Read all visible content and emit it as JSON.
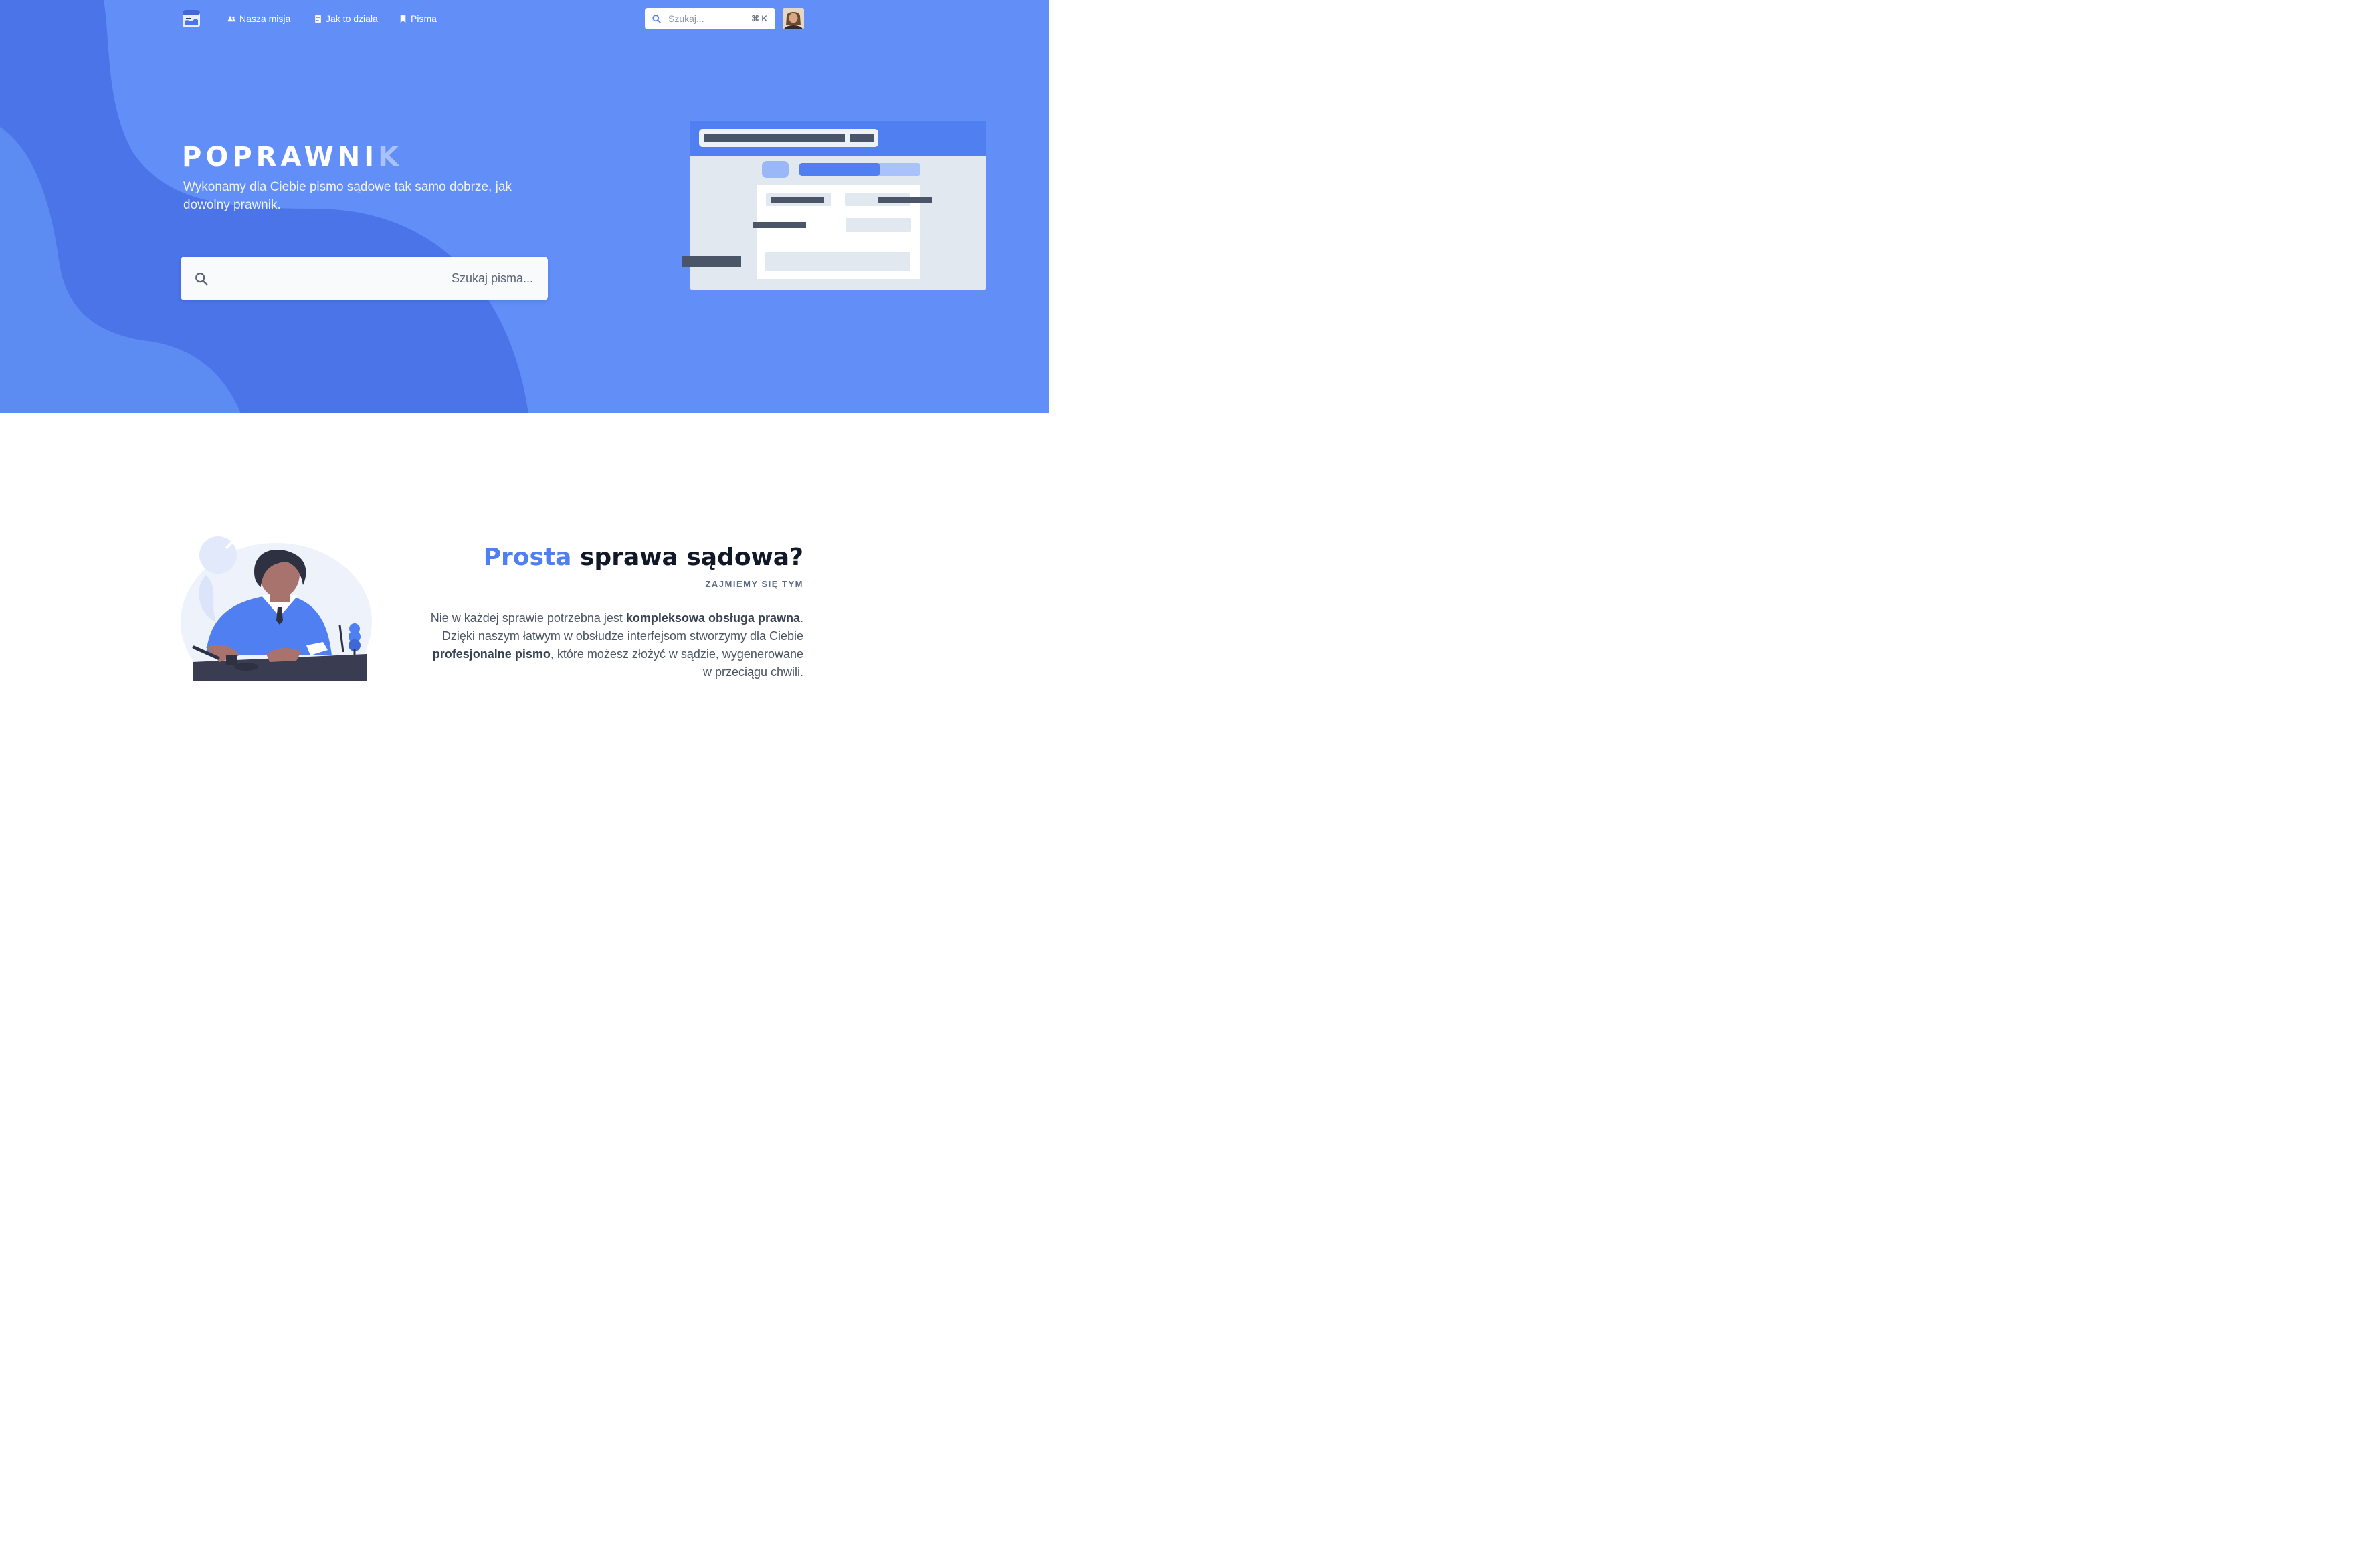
{
  "nav": {
    "links": [
      {
        "label": "Nasza misja",
        "icon": "users-icon"
      },
      {
        "label": "Jak to działa",
        "icon": "document-icon"
      },
      {
        "label": "Pisma",
        "icon": "bookmark-icon"
      }
    ],
    "search": {
      "placeholder": "Szukaj...",
      "shortcut": "⌘ K"
    }
  },
  "hero": {
    "title_main": "POPRAWNI",
    "title_accent": "K",
    "subtitle": "Wykonamy dla Ciebie pismo sądowe tak samo dobrze, jak dowolny prawnik.",
    "search_placeholder": "Szukaj pisma..."
  },
  "feature": {
    "title_accent": "Prosta",
    "title_rest": " sprawa sądowa?",
    "kicker": "ZAJMIEMY SIĘ TYM",
    "body": [
      {
        "text": "Nie w każdej sprawie potrzebna jest ",
        "bold": false
      },
      {
        "text": "kompleksowa obsługa prawna",
        "bold": true
      },
      {
        "text": ". Dzięki naszym łatwym w obsłudze interfejsom stworzymy dla Ciebie ",
        "bold": false
      },
      {
        "text": "profesjonalne pismo",
        "bold": true
      },
      {
        "text": ", które możesz złożyć w sądzie, wygenerowane w przeciągu chwili.",
        "bold": false
      }
    ]
  },
  "colors": {
    "hero_bg": "#618ef7",
    "wave_dark": "#4a74e8",
    "accent": "#4f7ff0"
  }
}
